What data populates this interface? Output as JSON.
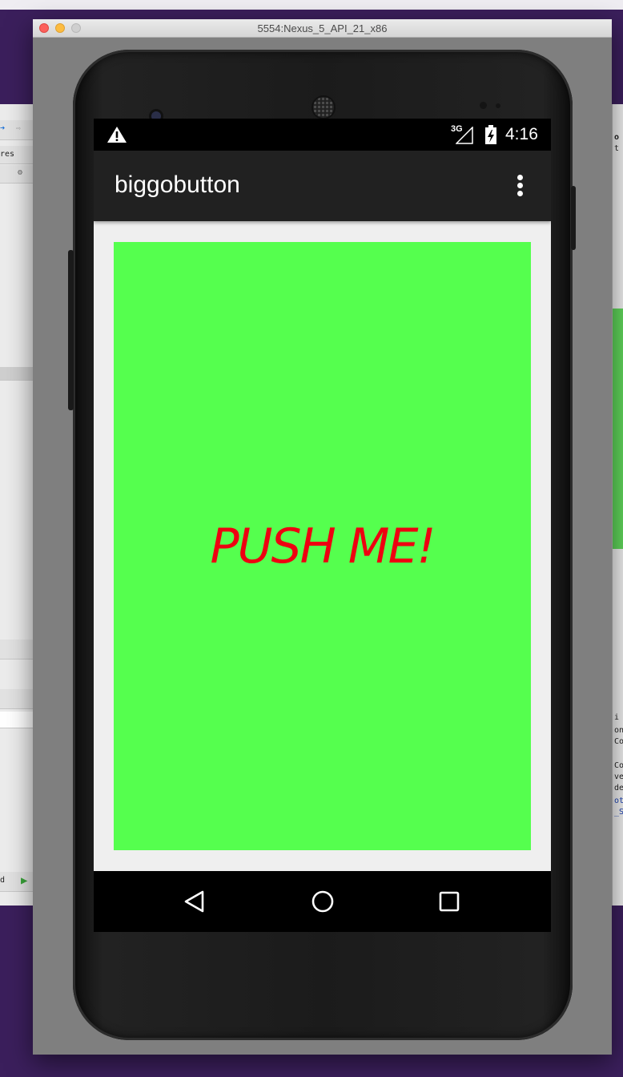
{
  "window": {
    "title": "5554:Nexus_5_API_21_x86"
  },
  "status_bar": {
    "warning_icon": "warning-icon",
    "network": "3G",
    "time": "4:16"
  },
  "app_bar": {
    "title": "biggobutton",
    "overflow_icon": "more-vert-icon"
  },
  "main_button": {
    "label": "PUSH ME!",
    "background_color": "#55ff4e",
    "text_color": "#ee0011"
  },
  "nav_bar": {
    "back": "back-icon",
    "home": "home-icon",
    "recents": "recents-icon"
  },
  "background_windows": {
    "left_fragments": [
      "res",
      "d"
    ],
    "right_fragments": [
      "o",
      "t t",
      "i",
      "ons",
      "Con",
      "Con",
      "ve",
      "de",
      "ot",
      "_SW"
    ]
  }
}
